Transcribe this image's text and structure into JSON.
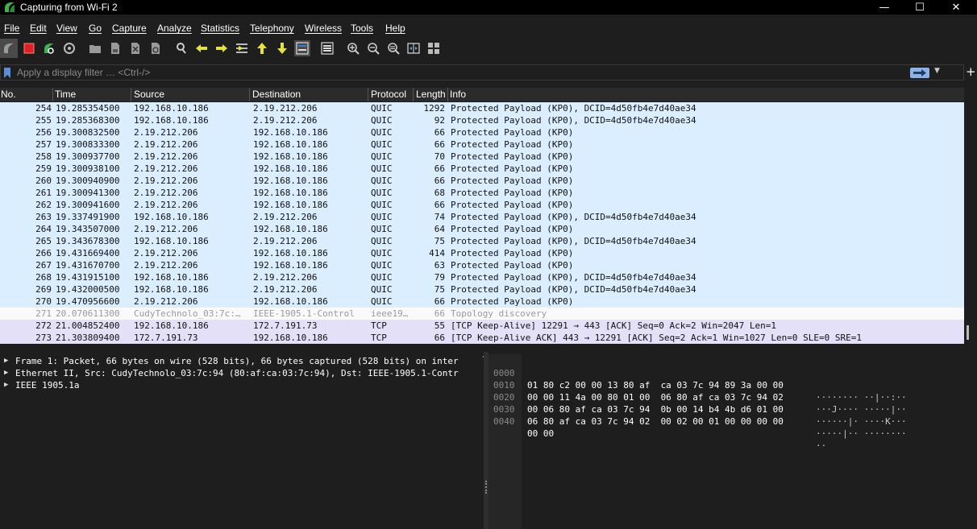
{
  "window": {
    "title": "Capturing from Wi-Fi 2",
    "controls": {
      "minimize": "—",
      "maximize": "☐",
      "close": "✕"
    }
  },
  "menu": [
    "File",
    "Edit",
    "View",
    "Go",
    "Capture",
    "Analyze",
    "Statistics",
    "Telephony",
    "Wireless",
    "Tools",
    "Help"
  ],
  "toolbar_icons": [
    "start-capture-icon",
    "stop-capture-icon",
    "restart-capture-icon",
    "capture-options-icon",
    "open-file-icon",
    "save-file-icon",
    "close-file-icon",
    "reload-file-icon",
    "find-packet-icon",
    "go-back-icon",
    "go-forward-icon",
    "go-to-packet-icon",
    "first-packet-icon",
    "last-packet-icon",
    "auto-scroll-icon",
    "colorize-icon",
    "zoom-in-icon",
    "zoom-out-icon",
    "normal-size-icon",
    "resize-columns-icon",
    "layout-icon"
  ],
  "filter": {
    "placeholder": "Apply a display filter … <Ctrl-/>",
    "value": ""
  },
  "columns": [
    "No.",
    "Time",
    "Source",
    "Destination",
    "Protocol",
    "Length",
    "Info"
  ],
  "colors": {
    "quic_row": "#daeeff",
    "ieee_row": "#fafafa",
    "tcp_row": "#e4e0f7",
    "ieee_text": "#9a9a9a"
  },
  "packets": [
    {
      "no": "254",
      "time": "19.285354500",
      "src": "192.168.10.186",
      "dst": "2.19.212.206",
      "proto": "QUIC",
      "len": "1292",
      "info": "Protected Payload (KP0), DCID=4d50fb4e7d40ae34",
      "kind": "quic"
    },
    {
      "no": "255",
      "time": "19.285368300",
      "src": "192.168.10.186",
      "dst": "2.19.212.206",
      "proto": "QUIC",
      "len": "92",
      "info": "Protected Payload (KP0), DCID=4d50fb4e7d40ae34",
      "kind": "quic"
    },
    {
      "no": "256",
      "time": "19.300832500",
      "src": "2.19.212.206",
      "dst": "192.168.10.186",
      "proto": "QUIC",
      "len": "66",
      "info": "Protected Payload (KP0)",
      "kind": "quic"
    },
    {
      "no": "257",
      "time": "19.300833300",
      "src": "2.19.212.206",
      "dst": "192.168.10.186",
      "proto": "QUIC",
      "len": "66",
      "info": "Protected Payload (KP0)",
      "kind": "quic"
    },
    {
      "no": "258",
      "time": "19.300937700",
      "src": "2.19.212.206",
      "dst": "192.168.10.186",
      "proto": "QUIC",
      "len": "70",
      "info": "Protected Payload (KP0)",
      "kind": "quic"
    },
    {
      "no": "259",
      "time": "19.300938100",
      "src": "2.19.212.206",
      "dst": "192.168.10.186",
      "proto": "QUIC",
      "len": "66",
      "info": "Protected Payload (KP0)",
      "kind": "quic"
    },
    {
      "no": "260",
      "time": "19.300940900",
      "src": "2.19.212.206",
      "dst": "192.168.10.186",
      "proto": "QUIC",
      "len": "66",
      "info": "Protected Payload (KP0)",
      "kind": "quic"
    },
    {
      "no": "261",
      "time": "19.300941300",
      "src": "2.19.212.206",
      "dst": "192.168.10.186",
      "proto": "QUIC",
      "len": "68",
      "info": "Protected Payload (KP0)",
      "kind": "quic"
    },
    {
      "no": "262",
      "time": "19.300941600",
      "src": "2.19.212.206",
      "dst": "192.168.10.186",
      "proto": "QUIC",
      "len": "66",
      "info": "Protected Payload (KP0)",
      "kind": "quic"
    },
    {
      "no": "263",
      "time": "19.337491900",
      "src": "192.168.10.186",
      "dst": "2.19.212.206",
      "proto": "QUIC",
      "len": "74",
      "info": "Protected Payload (KP0), DCID=4d50fb4e7d40ae34",
      "kind": "quic"
    },
    {
      "no": "264",
      "time": "19.343507000",
      "src": "2.19.212.206",
      "dst": "192.168.10.186",
      "proto": "QUIC",
      "len": "64",
      "info": "Protected Payload (KP0)",
      "kind": "quic"
    },
    {
      "no": "265",
      "time": "19.343678300",
      "src": "192.168.10.186",
      "dst": "2.19.212.206",
      "proto": "QUIC",
      "len": "75",
      "info": "Protected Payload (KP0), DCID=4d50fb4e7d40ae34",
      "kind": "quic"
    },
    {
      "no": "266",
      "time": "19.431669400",
      "src": "2.19.212.206",
      "dst": "192.168.10.186",
      "proto": "QUIC",
      "len": "414",
      "info": "Protected Payload (KP0)",
      "kind": "quic"
    },
    {
      "no": "267",
      "time": "19.431670700",
      "src": "2.19.212.206",
      "dst": "192.168.10.186",
      "proto": "QUIC",
      "len": "63",
      "info": "Protected Payload (KP0)",
      "kind": "quic"
    },
    {
      "no": "268",
      "time": "19.431915100",
      "src": "192.168.10.186",
      "dst": "2.19.212.206",
      "proto": "QUIC",
      "len": "79",
      "info": "Protected Payload (KP0), DCID=4d50fb4e7d40ae34",
      "kind": "quic"
    },
    {
      "no": "269",
      "time": "19.432000500",
      "src": "192.168.10.186",
      "dst": "2.19.212.206",
      "proto": "QUIC",
      "len": "75",
      "info": "Protected Payload (KP0), DCID=4d50fb4e7d40ae34",
      "kind": "quic"
    },
    {
      "no": "270",
      "time": "19.470956600",
      "src": "2.19.212.206",
      "dst": "192.168.10.186",
      "proto": "QUIC",
      "len": "66",
      "info": "Protected Payload (KP0)",
      "kind": "quic"
    },
    {
      "no": "271",
      "time": "20.070611300",
      "src": "CudyTechnolo_03:7c:…",
      "dst": "IEEE-1905.1-Control",
      "proto": "ieee19…",
      "len": "66",
      "info": "Topology discovery",
      "kind": "ieee"
    },
    {
      "no": "272",
      "time": "21.004852400",
      "src": "192.168.10.186",
      "dst": "172.7.191.73",
      "proto": "TCP",
      "len": "55",
      "info": "[TCP Keep-Alive] 12291 → 443 [ACK] Seq=0 Ack=2 Win=2047 Len=1",
      "kind": "tcp"
    },
    {
      "no": "273",
      "time": "21.303809400",
      "src": "172.7.191.73",
      "dst": "192.168.10.186",
      "proto": "TCP",
      "len": "66",
      "info": "[TCP Keep-Alive ACK] 443 → 12291 [ACK] Seq=2 Ack=1 Win=1027 Len=0 SLE=0 SRE=1",
      "kind": "tcp"
    }
  ],
  "details": [
    "Frame 1: Packet, 66 bytes on wire (528 bits), 66 bytes captured (528 bits) on inter",
    "Ethernet II, Src: CudyTechnolo_03:7c:94 (80:af:ca:03:7c:94), Dst: IEEE-1905.1-Contr",
    "IEEE 1905.1a"
  ],
  "bytes": [
    {
      "offset": "0000",
      "hex": "01 80 c2 00 00 13 80 af  ca 03 7c 94 89 3a 00 00",
      "ascii": "········ ··|··:··"
    },
    {
      "offset": "0010",
      "hex": "00 00 11 4a 00 80 01 00  06 80 af ca 03 7c 94 02",
      "ascii": "···J···· ·····|··"
    },
    {
      "offset": "0020",
      "hex": "00 06 80 af ca 03 7c 94  0b 00 14 b4 4b d6 01 00",
      "ascii": "······|· ····K···"
    },
    {
      "offset": "0030",
      "hex": "06 80 af ca 03 7c 94 02  00 02 00 01 00 00 00 00",
      "ascii": "·····|·· ········"
    },
    {
      "offset": "0040",
      "hex": "00 00",
      "ascii": "··"
    }
  ]
}
